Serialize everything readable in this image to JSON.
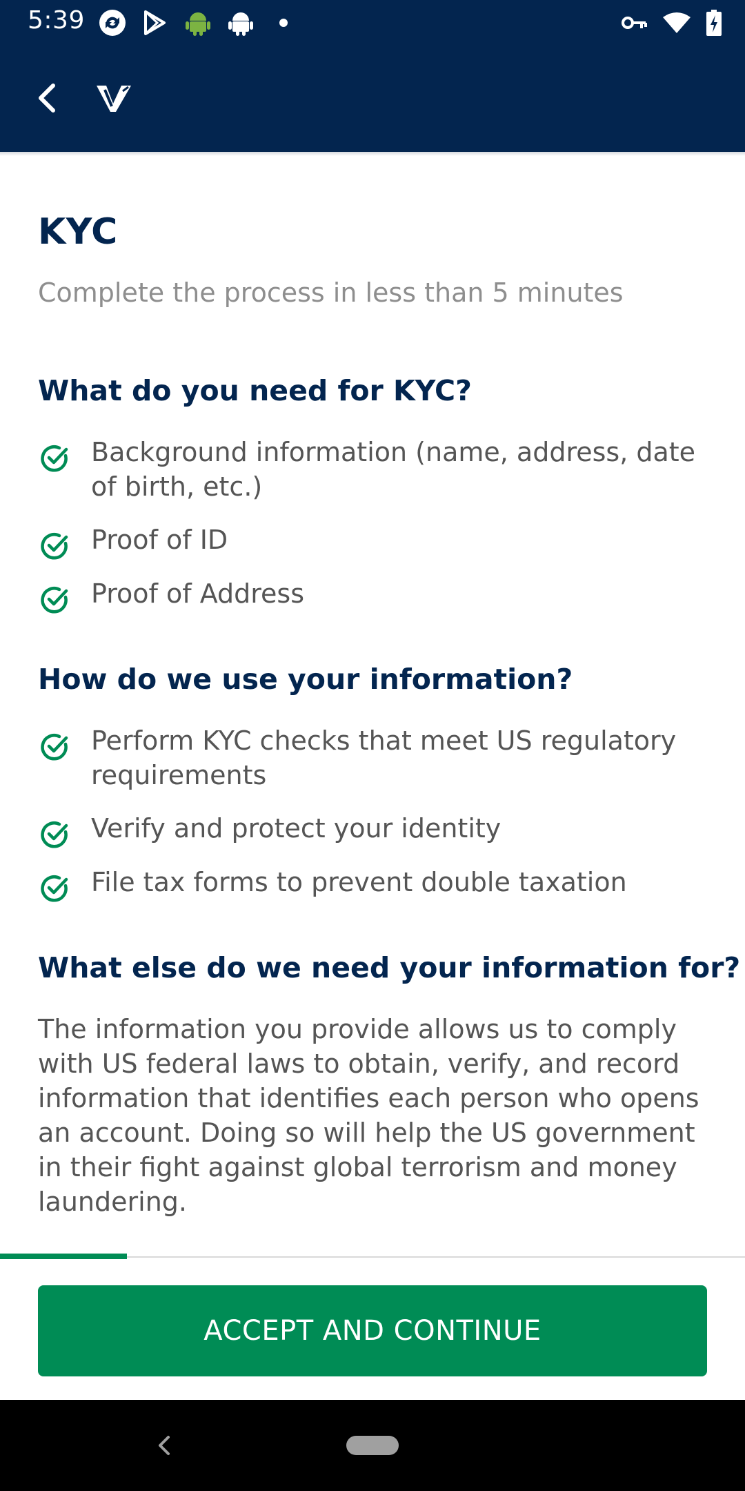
{
  "status_bar": {
    "time": "5:39",
    "left_icons": [
      "sync-icon",
      "play-store-icon",
      "android-icon",
      "android-icon",
      "dot-icon"
    ],
    "right_icons": [
      "vpn-key-icon",
      "wifi-icon",
      "battery-icon"
    ]
  },
  "app_bar": {
    "back_icon": "chevron-left-icon",
    "logo_icon": "v-logo-icon"
  },
  "page": {
    "title": "KYC",
    "subtitle": "Complete the process in less than 5 minutes"
  },
  "sections": [
    {
      "heading": "What do you need for KYC?",
      "items": [
        "Background information (name, address, date of birth, etc.)",
        "Proof of ID",
        "Proof of Address"
      ]
    },
    {
      "heading": "How do we use your information?",
      "items": [
        "Perform KYC checks that meet US regulatory requirements",
        "Verify and protect your identity",
        "File tax forms to prevent double taxation"
      ]
    },
    {
      "heading": "What else do we need your information for?",
      "paragraph": "The information you provide allows us to comply with US federal laws to obtain, verify, and record information that identifies each person who opens an account. Doing so will help the US government in their fight against global terrorism and money laundering."
    }
  ],
  "progress": {
    "fraction": 0.17
  },
  "footer": {
    "accept_label": "ACCEPT AND CONTINUE"
  },
  "colors": {
    "header_bg": "#03254f",
    "accent_green": "#008c55",
    "heading_navy": "#03254f",
    "body_gray": "#555555",
    "subtitle_gray": "#8e8e8e"
  }
}
